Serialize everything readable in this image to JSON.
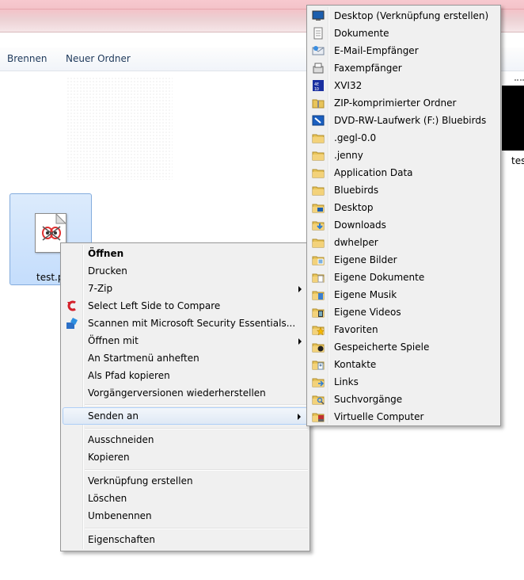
{
  "toolbar": {
    "burn": "Brennen",
    "new_folder": "Neuer Ordner"
  },
  "file": {
    "name": "test.p",
    "right_name": "tes"
  },
  "context_menu": {
    "open": "Öffnen",
    "print": "Drucken",
    "zip": "7-Zip",
    "compare": "Select Left Side to Compare",
    "scan": "Scannen mit Microsoft Security Essentials...",
    "open_with": "Öffnen mit",
    "pin_start": "An Startmenü anheften",
    "copy_path": "Als Pfad kopieren",
    "restore": "Vorgängerversionen wiederherstellen",
    "send_to": "Senden an",
    "cut": "Ausschneiden",
    "copy": "Kopieren",
    "shortcut": "Verknüpfung erstellen",
    "delete": "Löschen",
    "rename": "Umbenennen",
    "properties": "Eigenschaften"
  },
  "send_to_menu": {
    "items": [
      {
        "label": "Desktop (Verknüpfung erstellen)",
        "icon": "desktop-icon"
      },
      {
        "label": "Dokumente",
        "icon": "document-icon"
      },
      {
        "label": "E-Mail-Empfänger",
        "icon": "mail-icon"
      },
      {
        "label": "Faxempfänger",
        "icon": "fax-icon"
      },
      {
        "label": "XVI32",
        "icon": "hex-editor-icon"
      },
      {
        "label": "ZIP-komprimierter Ordner",
        "icon": "zip-folder-icon"
      },
      {
        "label": "DVD-RW-Laufwerk (F:) Bluebirds",
        "icon": "dvd-drive-icon"
      },
      {
        "label": ".gegl-0.0",
        "icon": "folder-icon"
      },
      {
        "label": ".jenny",
        "icon": "folder-icon"
      },
      {
        "label": "Application Data",
        "icon": "folder-icon"
      },
      {
        "label": "Bluebirds",
        "icon": "folder-icon"
      },
      {
        "label": "Desktop",
        "icon": "desktop-folder-icon"
      },
      {
        "label": "Downloads",
        "icon": "downloads-folder-icon"
      },
      {
        "label": "dwhelper",
        "icon": "folder-icon"
      },
      {
        "label": "Eigene Bilder",
        "icon": "pictures-folder-icon"
      },
      {
        "label": "Eigene Dokumente",
        "icon": "documents-folder-icon"
      },
      {
        "label": "Eigene Musik",
        "icon": "music-folder-icon"
      },
      {
        "label": "Eigene Videos",
        "icon": "videos-folder-icon"
      },
      {
        "label": "Favoriten",
        "icon": "favorites-folder-icon"
      },
      {
        "label": "Gespeicherte Spiele",
        "icon": "saved-games-folder-icon"
      },
      {
        "label": "Kontakte",
        "icon": "contacts-folder-icon"
      },
      {
        "label": "Links",
        "icon": "links-folder-icon"
      },
      {
        "label": "Suchvorgänge",
        "icon": "searches-folder-icon"
      },
      {
        "label": "Virtuelle Computer",
        "icon": "virtual-machines-folder-icon"
      }
    ]
  },
  "colors": {
    "highlight_border": "#aecff7",
    "menu_bg": "#f0f0f0",
    "folder": "#e8c45a"
  }
}
